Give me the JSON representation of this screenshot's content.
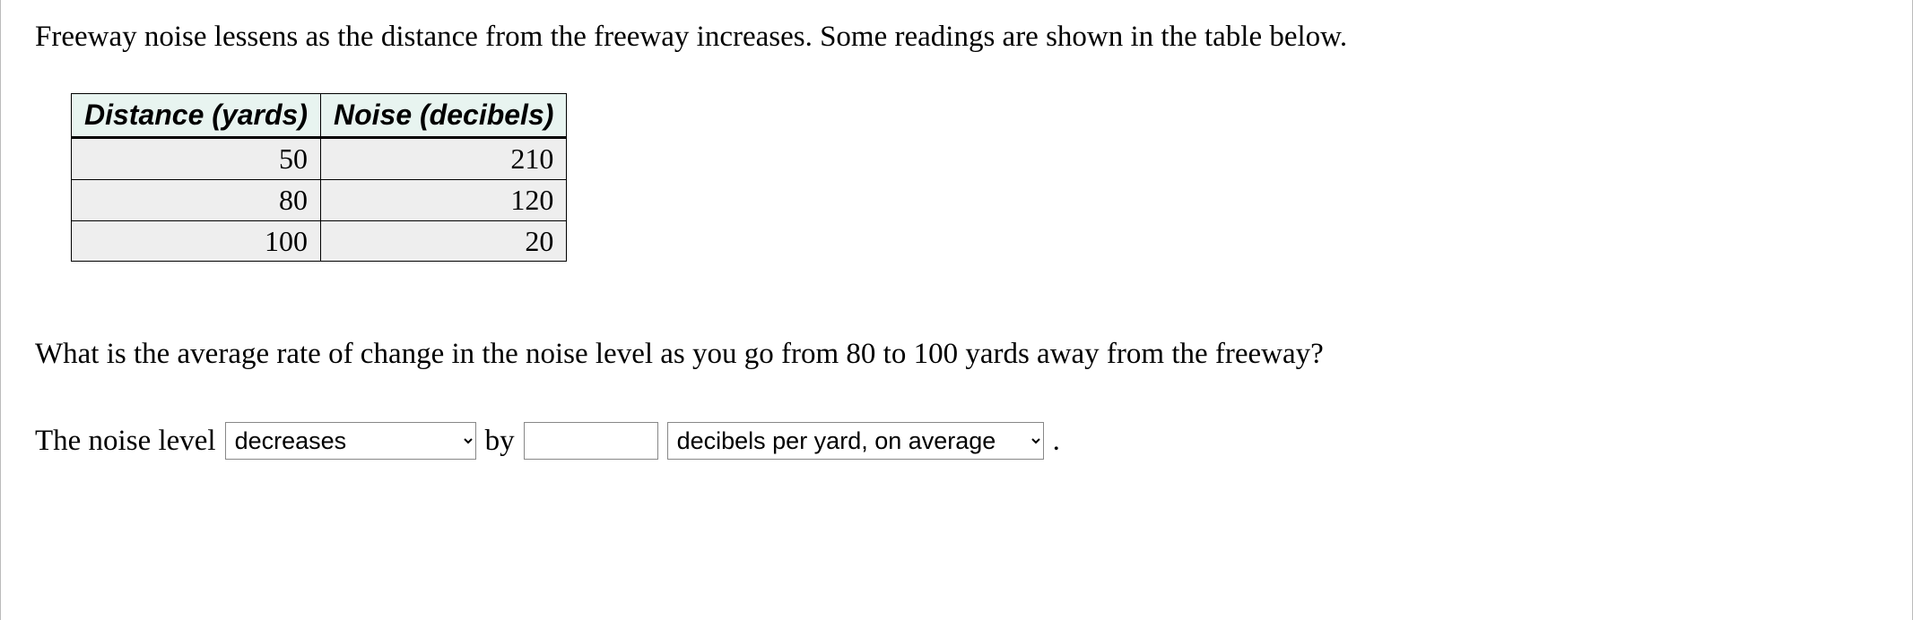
{
  "intro": "Freeway noise lessens as the distance from the freeway increases. Some readings are shown in the table below.",
  "table": {
    "headers": [
      "Distance (yards)",
      "Noise (decibels)"
    ],
    "rows": [
      {
        "c0": "50",
        "c1": "210"
      },
      {
        "c0": "80",
        "c1": "120"
      },
      {
        "c0": "100",
        "c1": "20"
      }
    ]
  },
  "question": "What is the average rate of change in the noise level as you go from 80 to 100 yards away from the freeway?",
  "answer": {
    "prefix": "The noise level",
    "direction_selected": "decreases",
    "by_label": "by",
    "value": "",
    "units_selected": "decibels per yard, on average",
    "period": "."
  }
}
